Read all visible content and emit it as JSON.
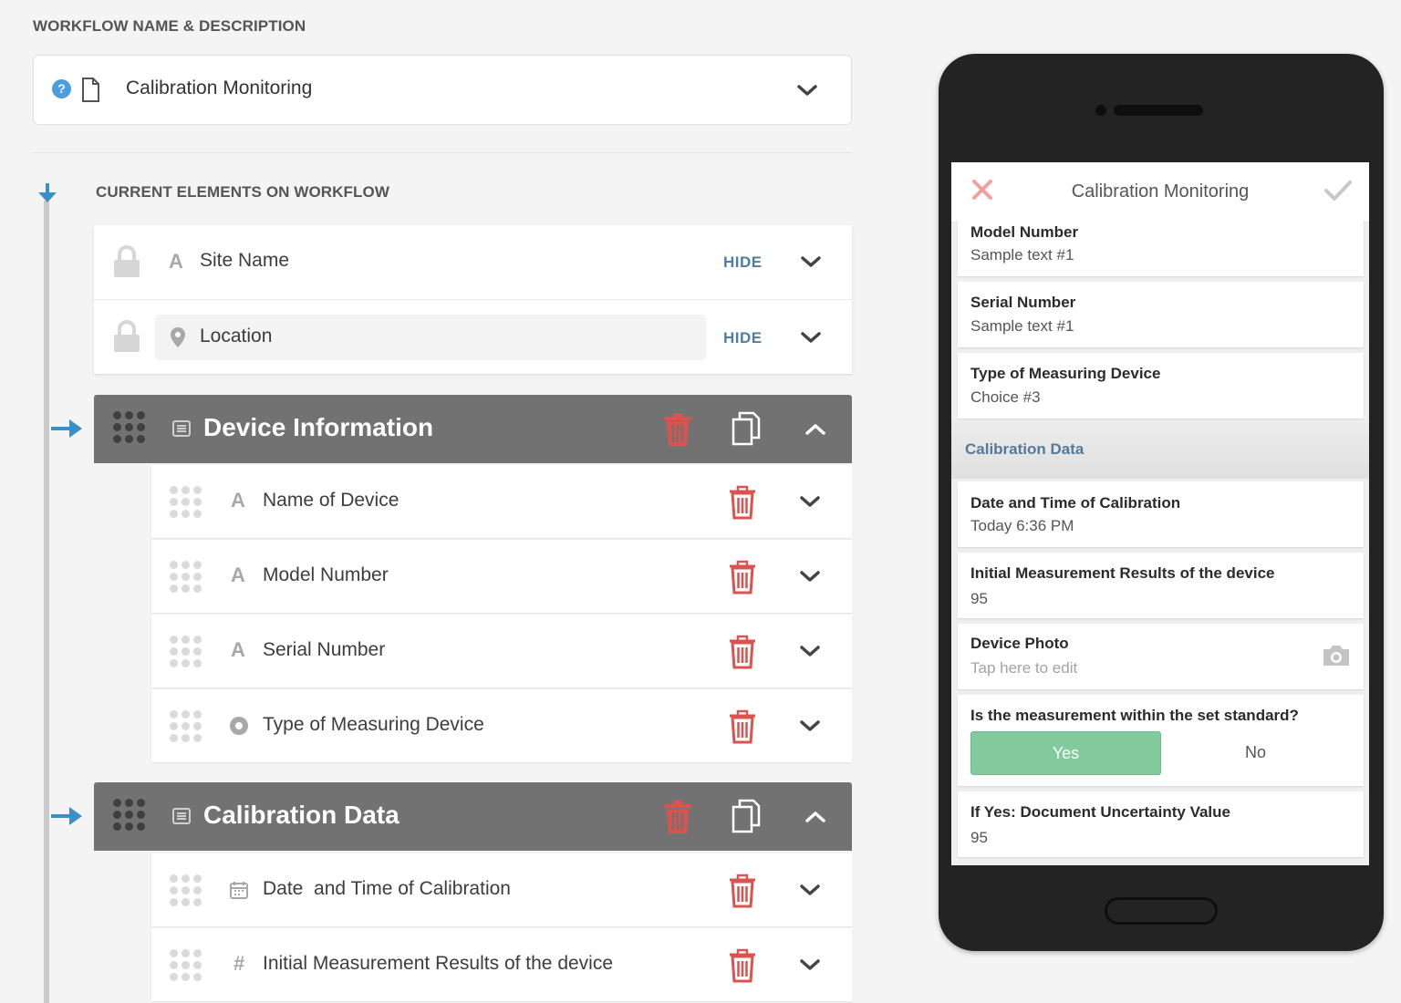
{
  "header": {
    "workflow_section_title": "WORKFLOW NAME & DESCRIPTION",
    "workflow_name": "Calibration Monitoring",
    "elements_section_title": "CURRENT ELEMENTS ON WORKFLOW"
  },
  "fixed_fields": [
    {
      "label": "Site Name",
      "icon": "text-A-icon",
      "action": "HIDE"
    },
    {
      "label": "Location",
      "icon": "map-pin-icon",
      "action": "HIDE"
    }
  ],
  "sections": [
    {
      "title": "Device Information",
      "items": [
        {
          "label": "Name of Device",
          "icon": "text-A-icon",
          "glyph": "A"
        },
        {
          "label": "Model Number",
          "icon": "text-A-icon",
          "glyph": "A"
        },
        {
          "label": "Serial Number",
          "icon": "text-A-icon",
          "glyph": "A"
        },
        {
          "label": "Type of Measuring Device",
          "icon": "radio-icon",
          "glyph": ""
        }
      ]
    },
    {
      "title": "Calibration Data",
      "items": [
        {
          "label": "Date  and Time of Calibration",
          "icon": "calendar-icon",
          "glyph": ""
        },
        {
          "label": "Initial Measurement Results of the device",
          "icon": "number-hash-icon",
          "glyph": "#"
        }
      ]
    }
  ],
  "preview": {
    "title": "Calibration Monitoring",
    "cards": [
      {
        "label": "Model Number",
        "value": "Sample text #1"
      },
      {
        "label": "Serial Number",
        "value": "Sample text #1"
      },
      {
        "label": "Type of Measuring Device",
        "value": "Choice #3"
      }
    ],
    "section_title": "Calibration Data",
    "cards2": [
      {
        "label": "Date and Time of Calibration",
        "value": "Today 6:36 PM"
      },
      {
        "label": "Initial Measurement Results of the device",
        "value": "95"
      },
      {
        "label": "Device Photo",
        "hint": "Tap here to edit"
      },
      {
        "label": "Is the measurement within the set standard?",
        "yes": "Yes",
        "no": "No",
        "selected": "Yes"
      },
      {
        "label": "If Yes: Document Uncertainty Value",
        "value": "95"
      }
    ]
  },
  "colors": {
    "accent_blue": "#3a8fc4",
    "trash_red": "#d9534f",
    "yes_green": "#82c99c",
    "section_bar": "#727272",
    "link_blue": "#4f7ea3"
  }
}
